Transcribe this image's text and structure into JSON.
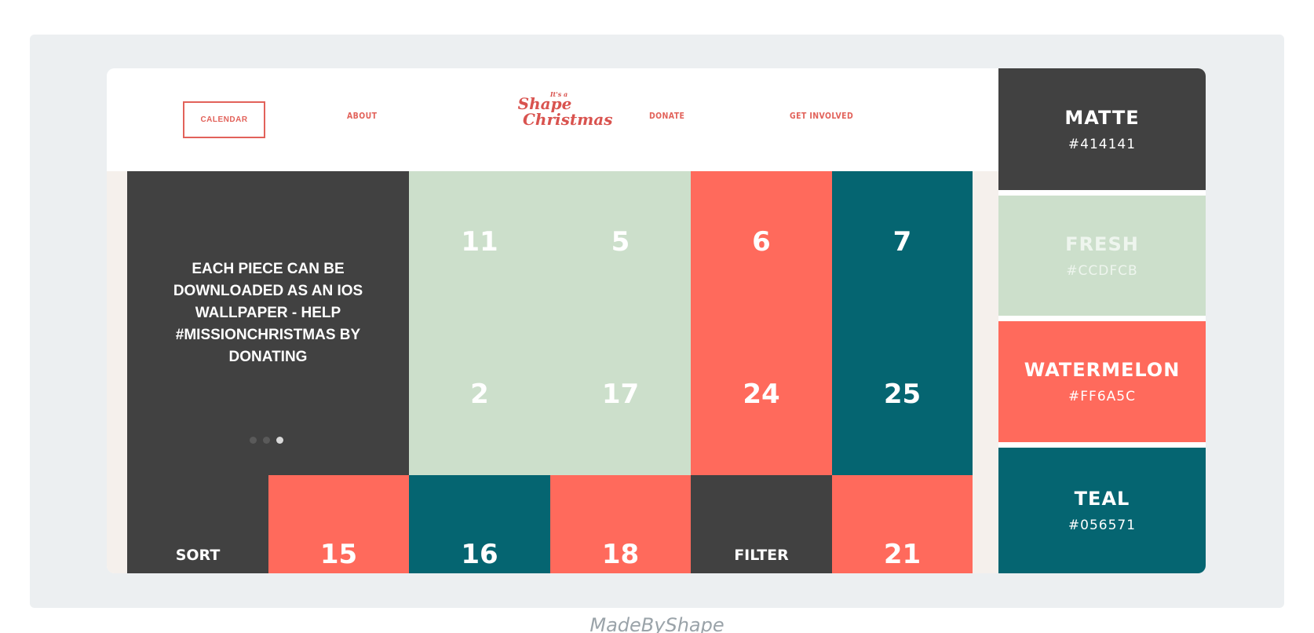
{
  "nav": {
    "calendar": "CALENDAR",
    "about": "ABOUT",
    "donate": "DONATE",
    "get_involved": "GET INVOLVED"
  },
  "logo": {
    "its": "It's a",
    "shape": "Shape",
    "christmas": "Christmas"
  },
  "intro": {
    "text": "EACH PIECE CAN BE DOWNLOADED AS AN IOS WALLPAPER - HELP #MISSIONCHRISTMAS BY DONATING",
    "carousel_dots": 3,
    "active_dot": 3
  },
  "tiles": {
    "top_row": [
      "11",
      "5",
      "6",
      "7"
    ],
    "middle_row": [
      "2",
      "17",
      "24",
      "25"
    ],
    "bottom_row": [
      "SORT",
      "15",
      "16",
      "18",
      "FILTER",
      "21"
    ]
  },
  "swatches": [
    {
      "name": "MATTE",
      "hex": "#414141"
    },
    {
      "name": "FRESH",
      "hex": "#CCDFCB"
    },
    {
      "name": "WATERMELON",
      "hex": "#FF6A5C"
    },
    {
      "name": "TEAL",
      "hex": "#056571"
    }
  ],
  "colors": {
    "matte": "#414141",
    "fresh": "#ccdfcb",
    "watermelon": "#ff6a5c",
    "teal": "#056571",
    "accent": "#e2625a"
  },
  "caption": "MadeByShape"
}
